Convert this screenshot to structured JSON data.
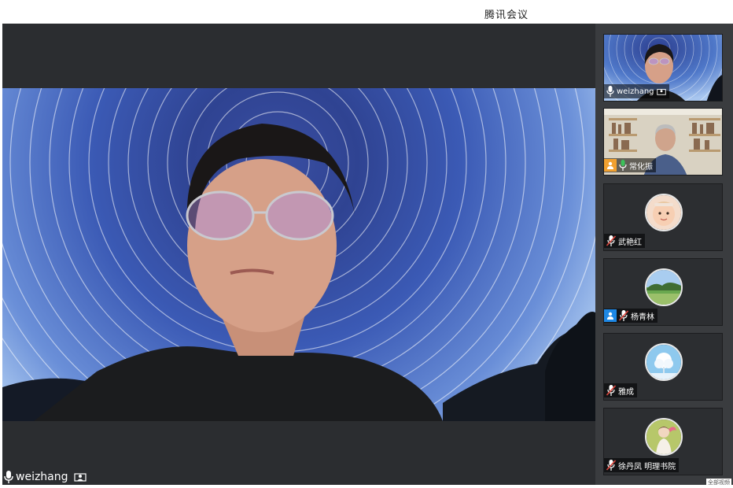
{
  "window": {
    "title": "腾讯会议"
  },
  "main_speaker": {
    "name": "weizhang"
  },
  "participants": [
    {
      "name": "weizhang",
      "mic": "on",
      "has_role_badge": false
    },
    {
      "name": "常化振",
      "mic": "on",
      "has_role_badge": true,
      "badge_color": "#f0a030"
    },
    {
      "name": "武艳红",
      "mic": "muted",
      "has_role_badge": false
    },
    {
      "name": "杨青林",
      "mic": "muted",
      "has_role_badge": true,
      "badge_color": "#1e88e5"
    },
    {
      "name": "雅成",
      "mic": "muted",
      "has_role_badge": false
    },
    {
      "name": "徐丹凤 明理书院",
      "mic": "muted",
      "has_role_badge": false
    }
  ],
  "corner_text": "全部视频",
  "colors": {
    "mute_red": "#e0463c",
    "mic_green": "#3cc25a",
    "sidebar_bg": "#3a3c3f",
    "stage_bg": "#2b2d30"
  }
}
